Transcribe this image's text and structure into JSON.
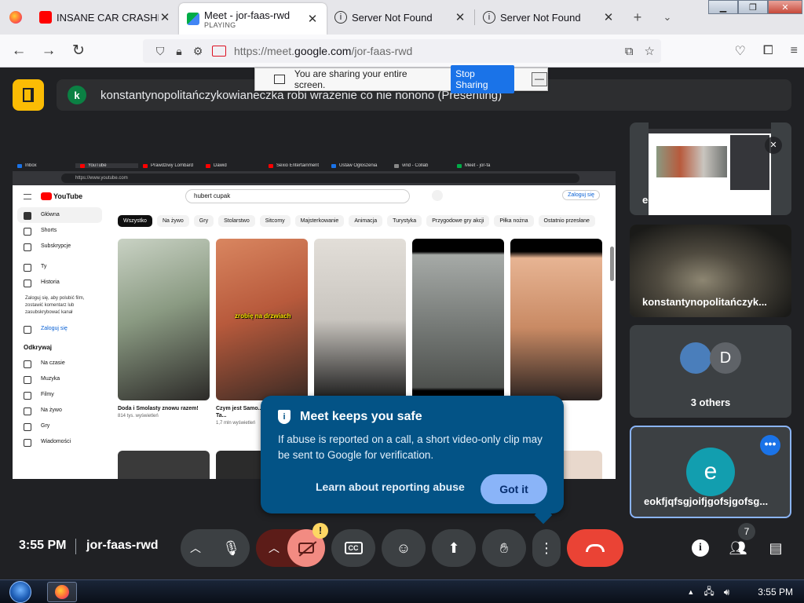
{
  "browser": {
    "tabs": [
      {
        "title": "INSANE CAR CRASHES",
        "subtitle": "",
        "active": false
      },
      {
        "title": "Meet - jor-faas-rwd",
        "subtitle": "PLAYING",
        "active": true
      },
      {
        "title": "Server Not Found",
        "subtitle": "",
        "active": false
      },
      {
        "title": "Server Not Found",
        "subtitle": "",
        "active": false
      }
    ],
    "url_prefix": "https://meet.",
    "url_domain": "google.com",
    "url_path": "/jor-faas-rwd"
  },
  "share_banner": {
    "text": "You are sharing your entire screen.",
    "stop_label": "Stop Sharing",
    "minimize_label": "—"
  },
  "presenter": {
    "avatar_letter": "k",
    "text": "konstantynopolitańczykowianeczka robi wrażenie co nie nonono (Presenting)"
  },
  "shared_screen": {
    "tabs": [
      "Inbox",
      "YouTube",
      "Prawdziwy Lombard",
      "Dawid",
      "Sexio Entertainment",
      "Ustaw Ogłoszenia",
      "vind - Collab",
      "Meet - jor-fa"
    ],
    "url": "https://www.youtube.com",
    "search_value": "hubert cupak",
    "login_label": "Zaloguj się",
    "logo_text": "YouTube",
    "sidebar": [
      "Główna",
      "Shorts",
      "Subskrypcje",
      "Ty",
      "Historia"
    ],
    "sidebar_note": "Zaloguj się, aby polubić film, zostawić komentarz lub zasubskrybować kanał",
    "sidebar_login": "Zaloguj się",
    "explore_heading": "Odkrywaj",
    "explore": [
      "Na czasie",
      "Muzyka",
      "Filmy",
      "Na żywo",
      "Gry",
      "Wiadomości"
    ],
    "chips": [
      "Wszystko",
      "Na żywo",
      "Gry",
      "Stolarstwo",
      "Sitcomy",
      "Majsterkowanie",
      "Animacja",
      "Turystyka",
      "Przygodowe gry akcji",
      "Piłka nożna",
      "Ostatnio przesłane"
    ],
    "videos": [
      {
        "title": "Doda i Smolasty znowu razem!",
        "meta": "814 tys. wyświetleń",
        "color": "#8a9a82"
      },
      {
        "title": "Czym jest Samo... Najlepsza Ta...",
        "meta": "1,7 mln wyświetleń",
        "color": "#b85a3c",
        "caption": "zrobię na drzwiach"
      },
      {
        "title": "",
        "meta": "",
        "color": "#c9c5bf"
      },
      {
        "title": "",
        "meta": "",
        "color": "#6f7370"
      },
      {
        "title": "",
        "meta": "",
        "color": "#c98a64"
      }
    ]
  },
  "participants": [
    {
      "name": "eokfjqfsgjoifjgofsjgofsg...",
      "type": "screen"
    },
    {
      "name": "konstantynopolitańczyk...",
      "type": "camera"
    },
    {
      "name": "3 others",
      "type": "others",
      "avatar": "D"
    },
    {
      "name": "eokfjqfsgjoifjgofsjgofsg...",
      "type": "avatar",
      "avatar": "e"
    }
  ],
  "popup": {
    "title": "Meet keeps you safe",
    "body": "If abuse is reported on a call, a short video-only clip may be sent to Google for verification.",
    "link": "Learn about reporting abuse",
    "button": "Got it"
  },
  "meeting": {
    "time": "3:55 PM",
    "code": "jor-faas-rwd",
    "people_count": "7",
    "warning": "!"
  },
  "taskbar": {
    "clock": "3:55 PM"
  },
  "colors": {
    "meet_bg": "#202124",
    "popup_bg": "#035386",
    "end_call": "#ea4335",
    "accent": "#8ab4f8"
  }
}
